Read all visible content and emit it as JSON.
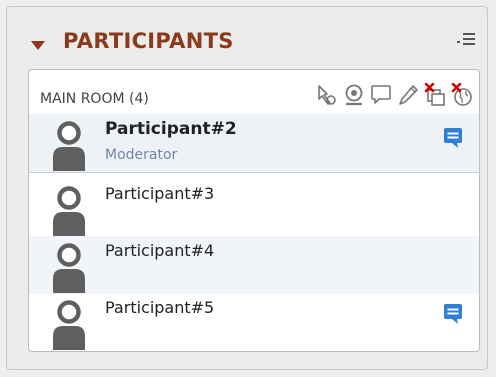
{
  "panel": {
    "title": "PARTICIPANTS"
  },
  "room": {
    "title": "MAIN ROOM (4)",
    "tools": [
      {
        "icon": "pointer-icon"
      },
      {
        "icon": "webcam-icon"
      },
      {
        "icon": "chat-bubble-icon"
      },
      {
        "icon": "pencil-icon"
      },
      {
        "icon": "share-screen-disabled-icon"
      },
      {
        "icon": "globe-disabled-icon"
      }
    ]
  },
  "participants": [
    {
      "name": "Participant#2",
      "role": "Moderator",
      "has_chat": true
    },
    {
      "name": "Participant#3",
      "role": "",
      "has_chat": false
    },
    {
      "name": "Participant#4",
      "role": "",
      "has_chat": false
    },
    {
      "name": "Participant#5",
      "role": "",
      "has_chat": true
    }
  ],
  "colors": {
    "title": "#8b3a1a",
    "chat_icon": "#2f7fd6",
    "role": "#6f87a8"
  }
}
